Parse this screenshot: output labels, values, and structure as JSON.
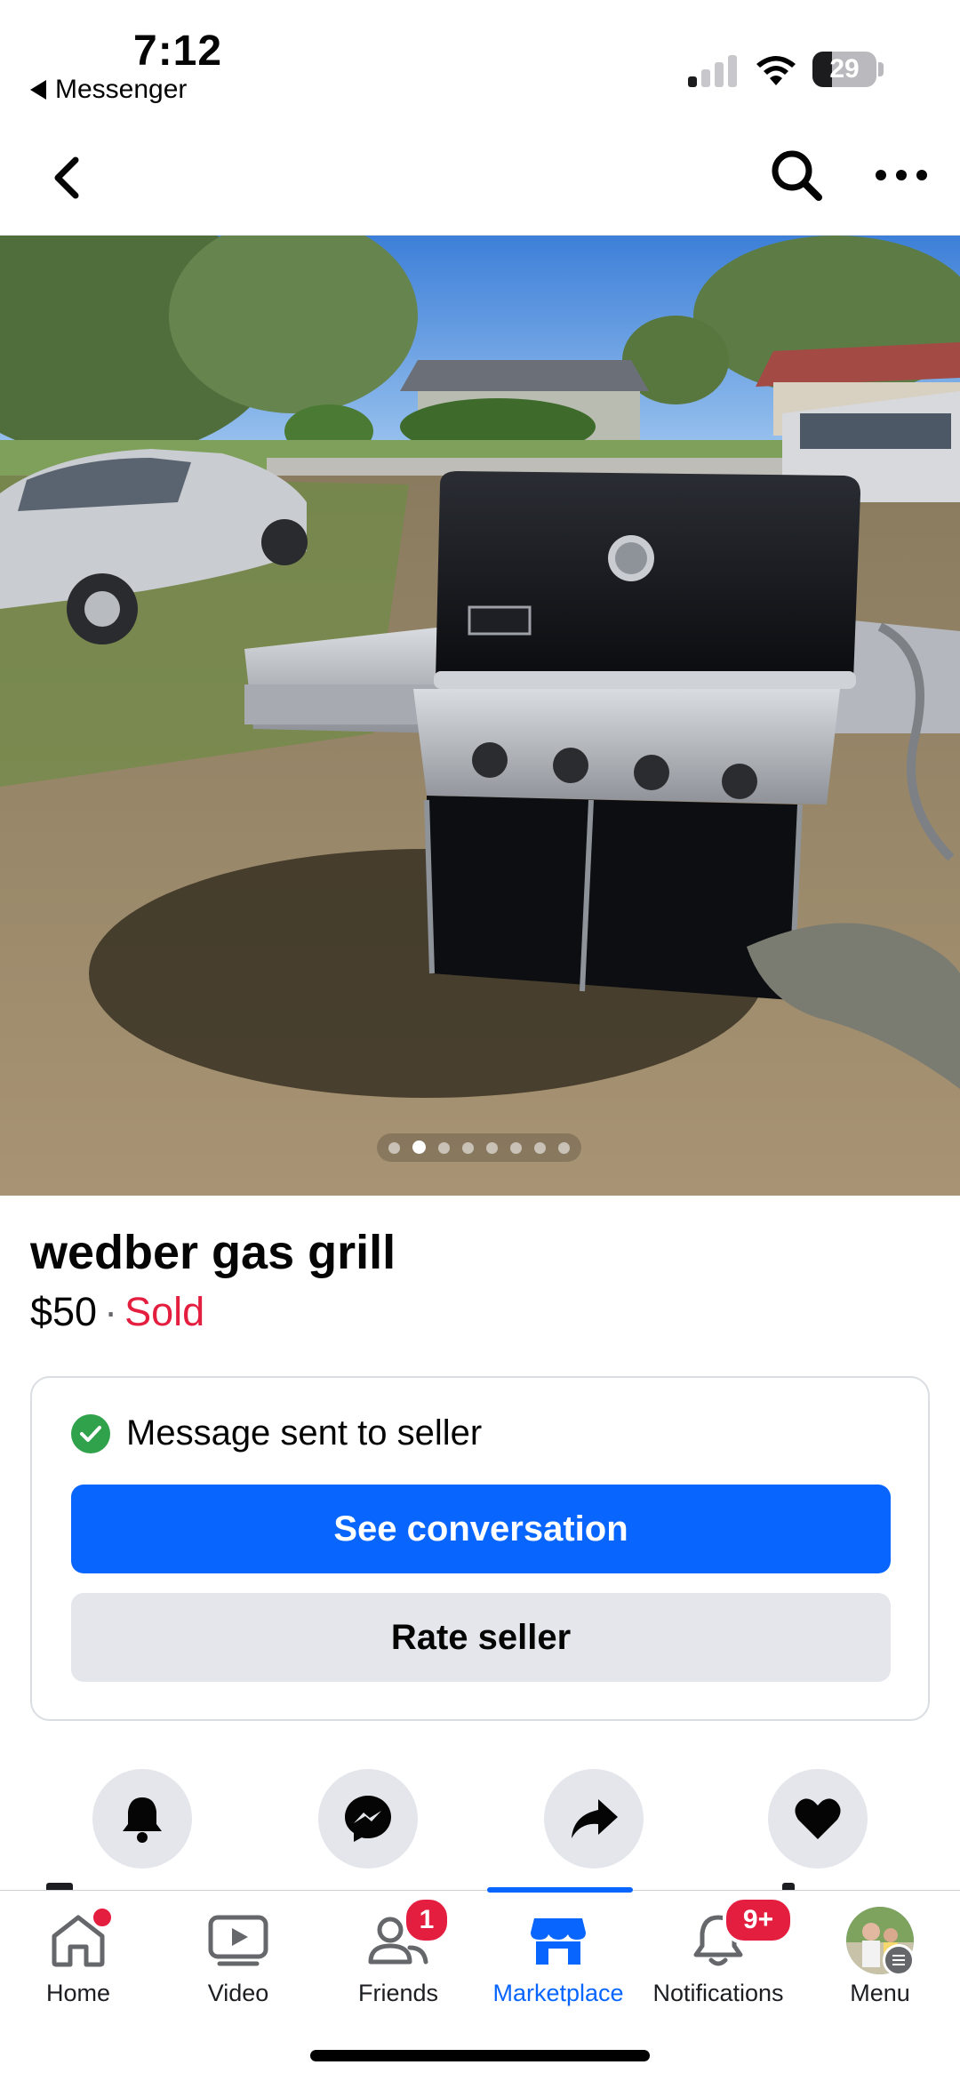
{
  "status_bar": {
    "time": "7:12",
    "back_app": "Messenger",
    "battery": "29"
  },
  "top_nav": {
    "back_icon": "chevron-left-icon",
    "search_icon": "search-icon",
    "more_icon": "more-horizontal-icon"
  },
  "photo": {
    "description_icon": "listing-photo",
    "dot_count": 8,
    "active_dot_index": 1
  },
  "listing": {
    "title": "wedber gas grill",
    "price": "$50",
    "separator": "·",
    "status": "Sold"
  },
  "card": {
    "message": "Message sent to seller",
    "primary_button": "See conversation",
    "secondary_button": "Rate seller"
  },
  "actions": [
    {
      "icon": "bell-icon"
    },
    {
      "icon": "messenger-icon"
    },
    {
      "icon": "share-icon"
    },
    {
      "icon": "heart-icon"
    }
  ],
  "tabbar": {
    "tabs": [
      {
        "label": "Home",
        "icon": "home-icon",
        "dot": true
      },
      {
        "label": "Video",
        "icon": "video-icon"
      },
      {
        "label": "Friends",
        "icon": "friends-icon",
        "badge": "1"
      },
      {
        "label": "Marketplace",
        "icon": "marketplace-icon",
        "active": true
      },
      {
        "label": "Notifications",
        "icon": "bell-icon",
        "badge": "9+"
      },
      {
        "label": "Menu",
        "icon": "avatar"
      }
    ]
  },
  "colors": {
    "accent": "#0866ff",
    "sold": "#e41e3f",
    "success": "#31a24c",
    "secondary_button": "#e4e6eb"
  }
}
